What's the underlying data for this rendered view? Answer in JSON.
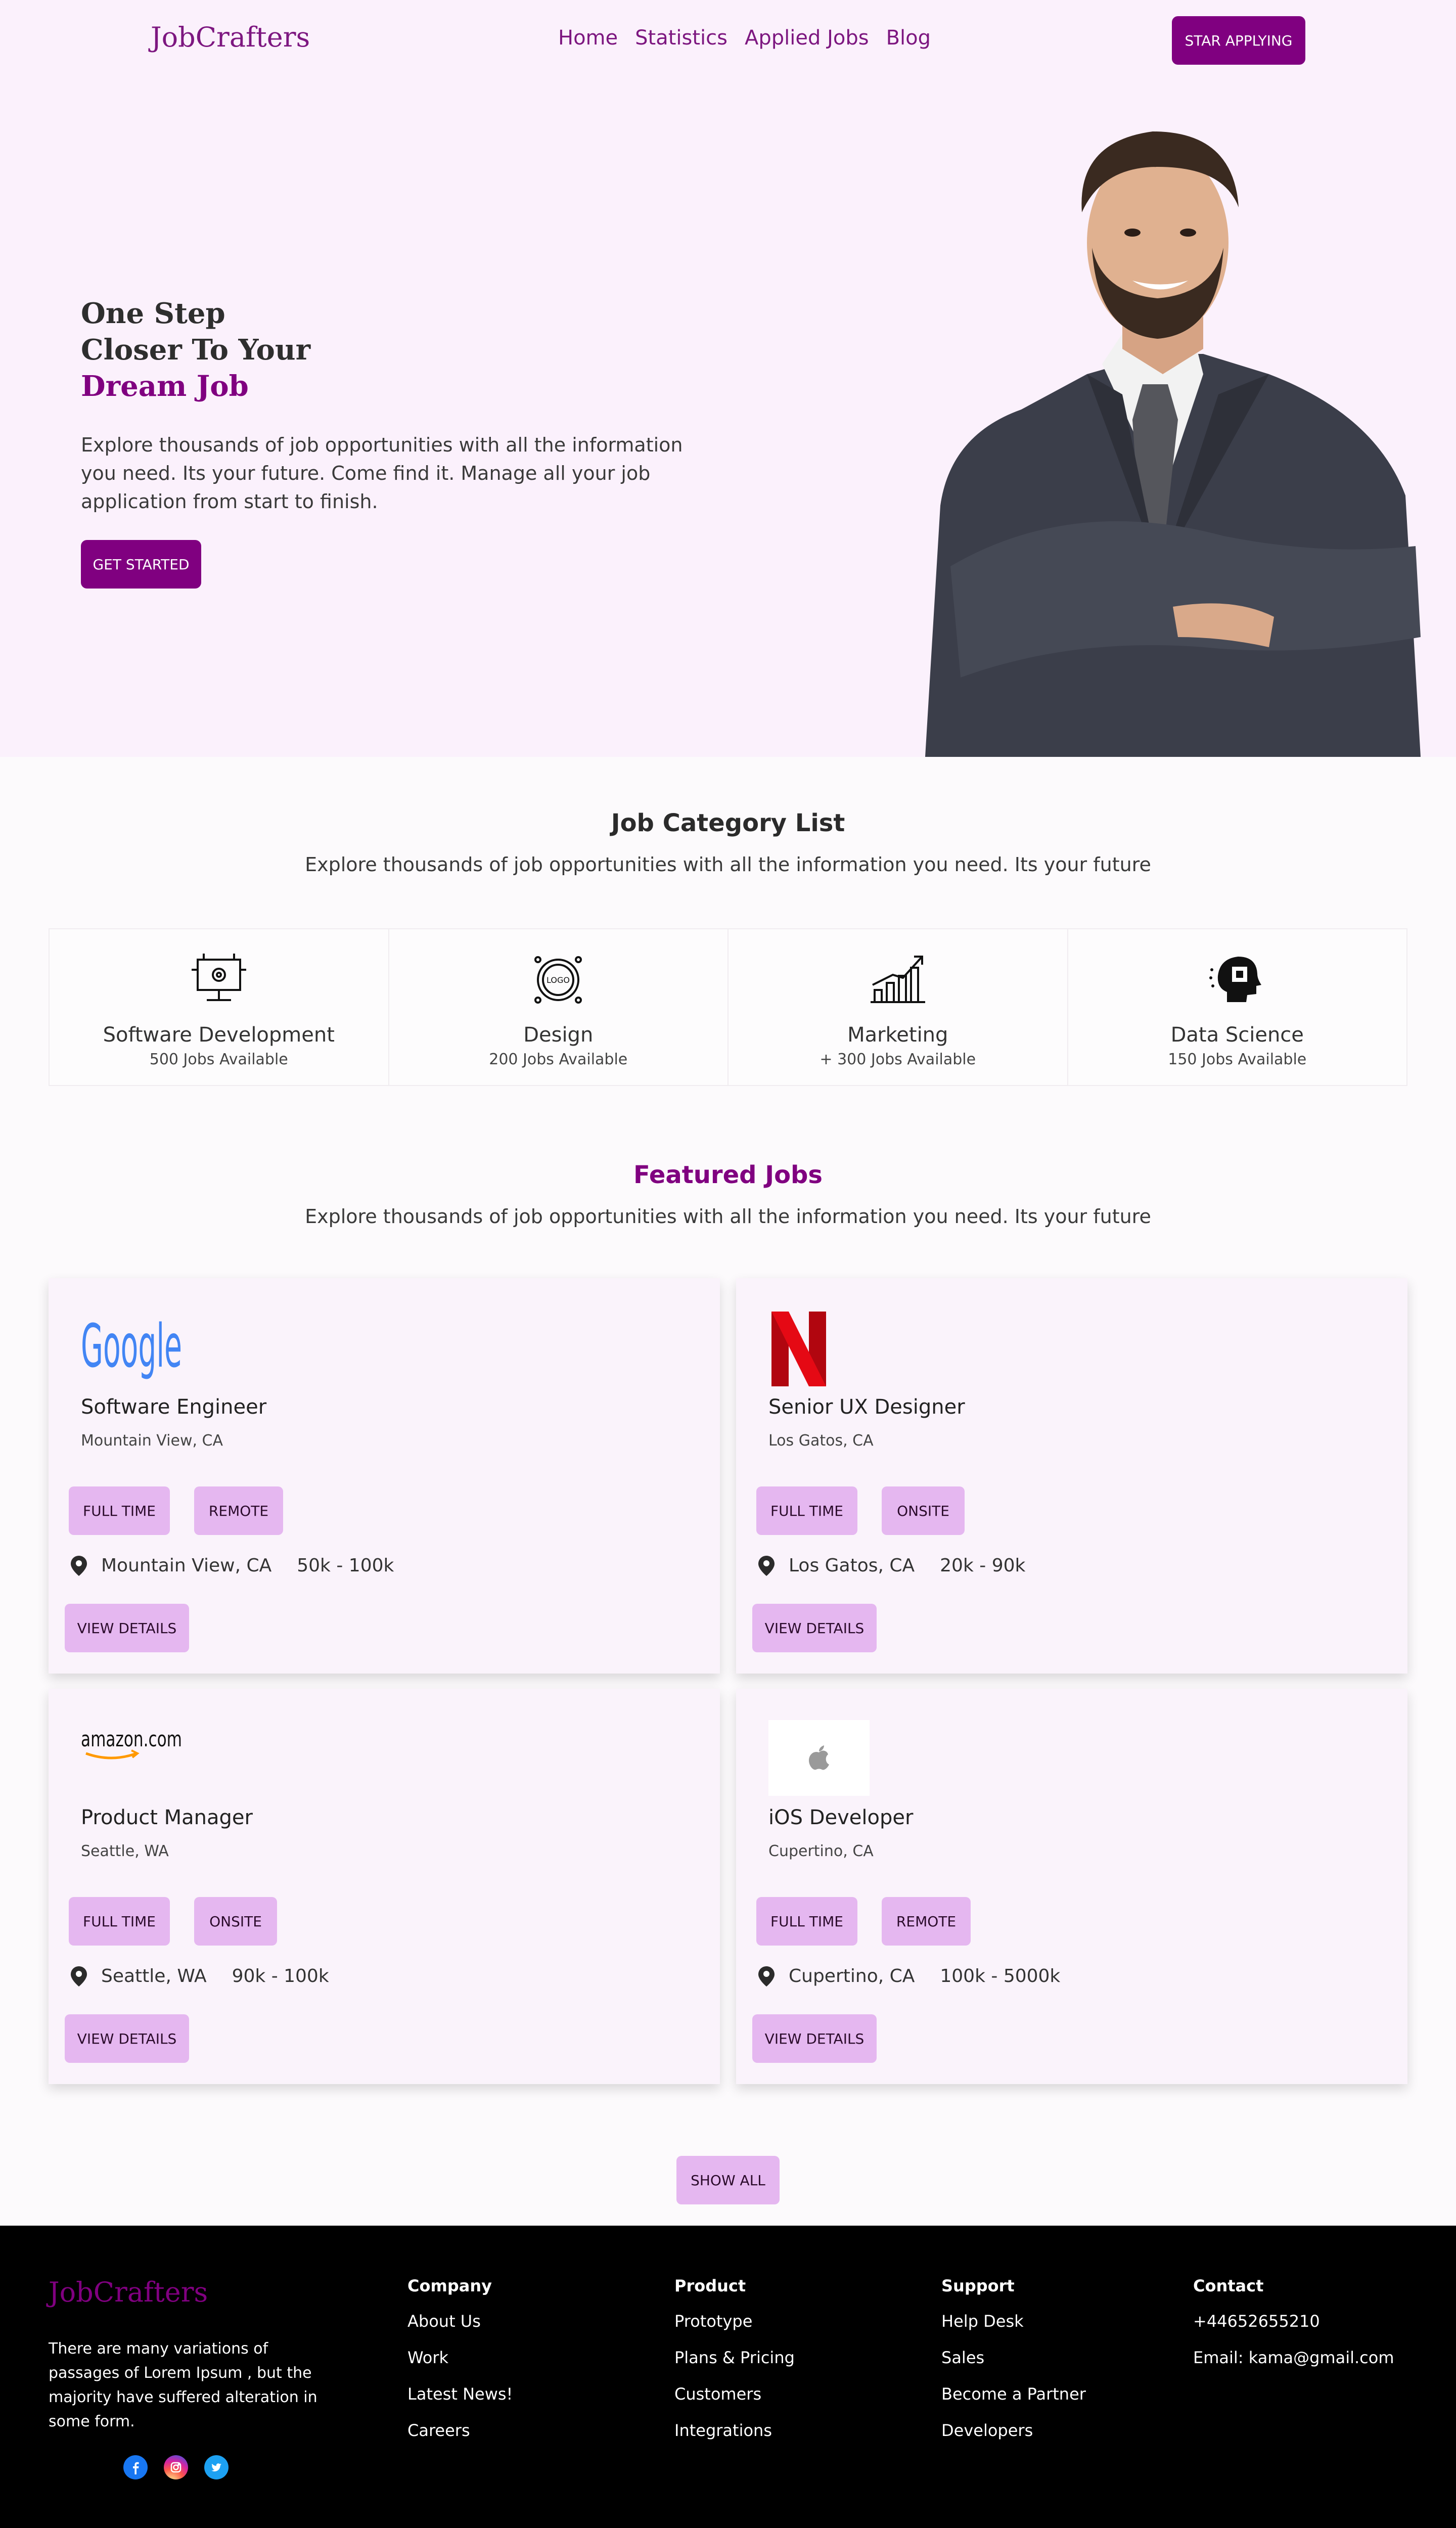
{
  "header": {
    "logo": "JobCrafters",
    "nav": [
      "Home",
      "Statistics",
      "Applied Jobs",
      "Blog"
    ],
    "cta": "STAR APPLYING"
  },
  "hero": {
    "title_line1": "One Step",
    "title_line2": "Closer To Your",
    "title_accent": "Dream Job",
    "description": "Explore thousands of job opportunities with all the information you need. Its your future. Come find it. Manage all your job application from start to finish.",
    "button": "GET STARTED"
  },
  "categories_section": {
    "title": "Job Category List",
    "subtitle": "Explore thousands of job opportunities with all the information you need. Its your future",
    "items": [
      {
        "name": "Software Development",
        "count": "500 Jobs Available",
        "icon": "monitor-gear-icon"
      },
      {
        "name": "Design",
        "count": "200 Jobs Available",
        "icon": "logo-design-icon"
      },
      {
        "name": "Marketing",
        "count": "+ 300 Jobs Available",
        "icon": "growth-chart-icon"
      },
      {
        "name": "Data Science",
        "count": "150 Jobs Available",
        "icon": "brain-chip-icon"
      }
    ]
  },
  "featured": {
    "title": "Featured Jobs",
    "subtitle": "Explore thousands of job opportunities with all the information you need. Its your future",
    "jobs": [
      {
        "company_logo": "Google",
        "title": "Software Engineer",
        "location": "Mountain View, CA",
        "type": "FULL TIME",
        "mode": "REMOTE",
        "salary": "50k - 100k",
        "button": "VIEW DETAILS"
      },
      {
        "company_logo": "N",
        "title": "Senior UX Designer",
        "location": "Los Gatos, CA",
        "type": "FULL TIME",
        "mode": "ONSITE",
        "salary": "20k - 90k",
        "button": "VIEW DETAILS"
      },
      {
        "company_logo": "amazon.com",
        "title": "Product Manager",
        "location": "Seattle, WA",
        "type": "FULL TIME",
        "mode": "ONSITE",
        "salary": "90k - 100k",
        "button": "VIEW DETAILS"
      },
      {
        "company_logo": "apple",
        "title": "iOS Developer",
        "location": "Cupertino, CA",
        "type": "FULL TIME",
        "mode": "REMOTE",
        "salary": "100k - 5000k",
        "button": "VIEW DETAILS"
      }
    ],
    "show_all": "SHOW ALL"
  },
  "footer": {
    "logo": "JobCrafters",
    "about": "There are many variations of passages of Lorem Ipsum , but the majority have suffered alteration in some form.",
    "columns": [
      {
        "heading": "Company",
        "links": [
          "About Us",
          "Work",
          "Latest News!",
          "Careers"
        ]
      },
      {
        "heading": "Product",
        "links": [
          "Prototype",
          "Plans & Pricing",
          "Customers",
          "Integrations"
        ]
      },
      {
        "heading": "Support",
        "links": [
          "Help Desk",
          "Sales",
          "Become a Partner",
          "Developers"
        ]
      },
      {
        "heading": "Contact",
        "links": [
          "+44652655210",
          "Email: kama@gmail.com"
        ]
      }
    ],
    "socials": [
      "facebook-icon",
      "instagram-icon",
      "twitter-icon"
    ]
  },
  "colors": {
    "brand": "#800080",
    "hero_bg": "#fbf1fc",
    "tag_bg": "#e5b7f0",
    "card_bg": "#faf3fb",
    "footer_bg": "#000000"
  }
}
